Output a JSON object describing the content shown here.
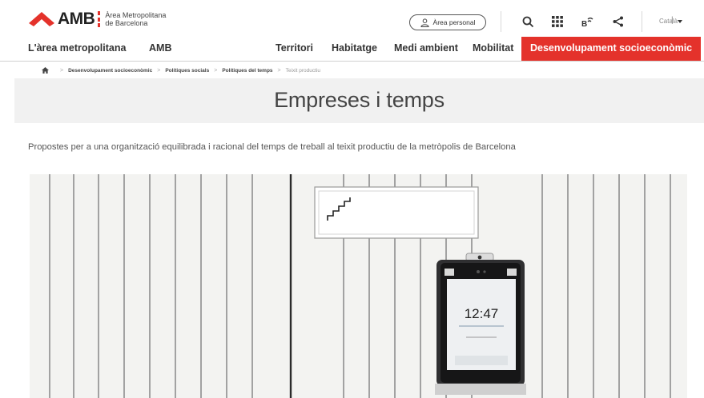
{
  "header": {
    "logo": {
      "name": "AMB",
      "subtitle_line1": "Àrea Metropolitana",
      "subtitle_line2": "de Barcelona"
    },
    "area_personal_label": "Àrea personal",
    "icons": [
      "search-icon",
      "apps-grid-icon",
      "accessibility-audio-icon",
      "share-icon"
    ],
    "language": "Català"
  },
  "nav": {
    "items": [
      {
        "label": "L'àrea metropolitana"
      },
      {
        "label": "AMB"
      },
      {
        "label": "Territori"
      },
      {
        "label": "Habitatge"
      },
      {
        "label": "Medi ambient"
      },
      {
        "label": "Mobilitat"
      },
      {
        "label": "Desenvolupament socioeconòmic",
        "active": true
      }
    ]
  },
  "breadcrumb": {
    "home_icon": "home-icon",
    "items": [
      "Desenvolupament socioeconòmic",
      "Polítiques socials",
      "Polítiques del temps",
      "Teixit productiu"
    ]
  },
  "page": {
    "title": "Empreses i temps",
    "intro": "Propostes per a una organització equilibrada i racional del temps de treball al teixit productiu de la metròpolis de Barcelona"
  },
  "hero_photo": {
    "clock_time": "12:47"
  },
  "colors": {
    "accent": "#e4322b",
    "band": "#f1f1f1",
    "text": "#333333"
  }
}
